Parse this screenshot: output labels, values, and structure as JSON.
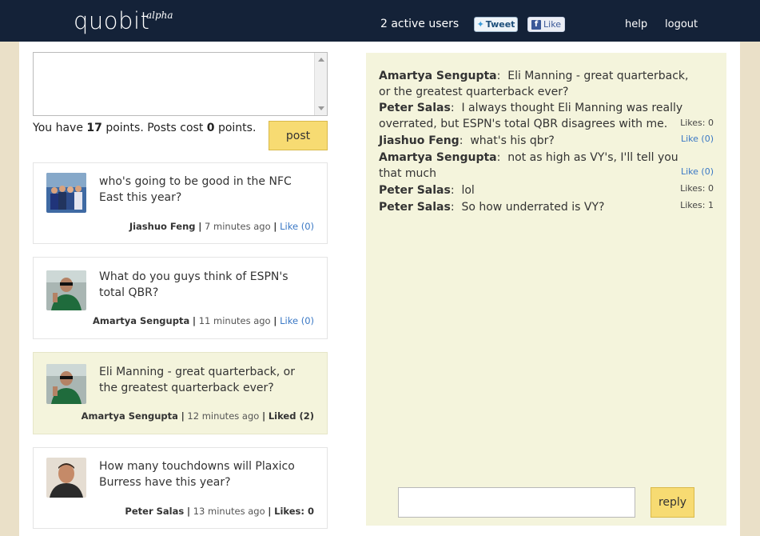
{
  "header": {
    "logo": "quobit",
    "logo_tag": "alpha",
    "active_users": "2 active users",
    "tweet_label": "Tweet",
    "fb_like_label": "Like",
    "nav": {
      "help": "help",
      "logout": "logout"
    }
  },
  "composer": {
    "textarea_value": "",
    "points_prefix": "You have",
    "points_value": "17",
    "points_mid": "points. Posts cost",
    "cost_value": "0",
    "points_suffix": "points.",
    "post_label": "post"
  },
  "questions": [
    {
      "text": "who's going to be good in the NFC East this year?",
      "author": "Jiashuo Feng",
      "time": "7 minutes ago",
      "like_label": "Like (0)",
      "liked": false
    },
    {
      "text": "What do you guys think of ESPN's total QBR?",
      "author": "Amartya Sengupta",
      "time": "11 minutes ago",
      "like_label": "Like (0)",
      "liked": false
    },
    {
      "text": "Eli Manning - great quarterback, or the greatest quarterback ever?",
      "author": "Amartya Sengupta",
      "time": "12 minutes ago",
      "like_label": "Liked (2)",
      "liked": true
    },
    {
      "text": "How many touchdowns will Plaxico Burress have this year?",
      "author": "Peter Salas",
      "time": "13 minutes ago",
      "like_label": "Likes: 0",
      "liked": false
    }
  ],
  "chat": {
    "messages": [
      {
        "speaker": "Amartya Sengupta",
        "text": "Eli Manning - great quarterback, or the greatest quarterback ever?",
        "likes": ""
      },
      {
        "speaker": "Peter Salas",
        "text": "I always thought Eli Manning was really overrated, but ESPN's total QBR disagrees with me.",
        "likes": "Likes: 0"
      },
      {
        "speaker": "Jiashuo Feng",
        "text": "what's his qbr?",
        "likes": "Like (0)"
      },
      {
        "speaker": "Amartya Sengupta",
        "text": "not as high as VY's, I'll tell you that much",
        "likes": "Like (0)"
      },
      {
        "speaker": "Peter Salas",
        "text": "lol",
        "likes": "Likes: 0"
      },
      {
        "speaker": "Peter Salas",
        "text": "So how underrated is VY?",
        "likes": "Likes: 1"
      }
    ],
    "reply_value": "",
    "reply_label": "reply"
  }
}
